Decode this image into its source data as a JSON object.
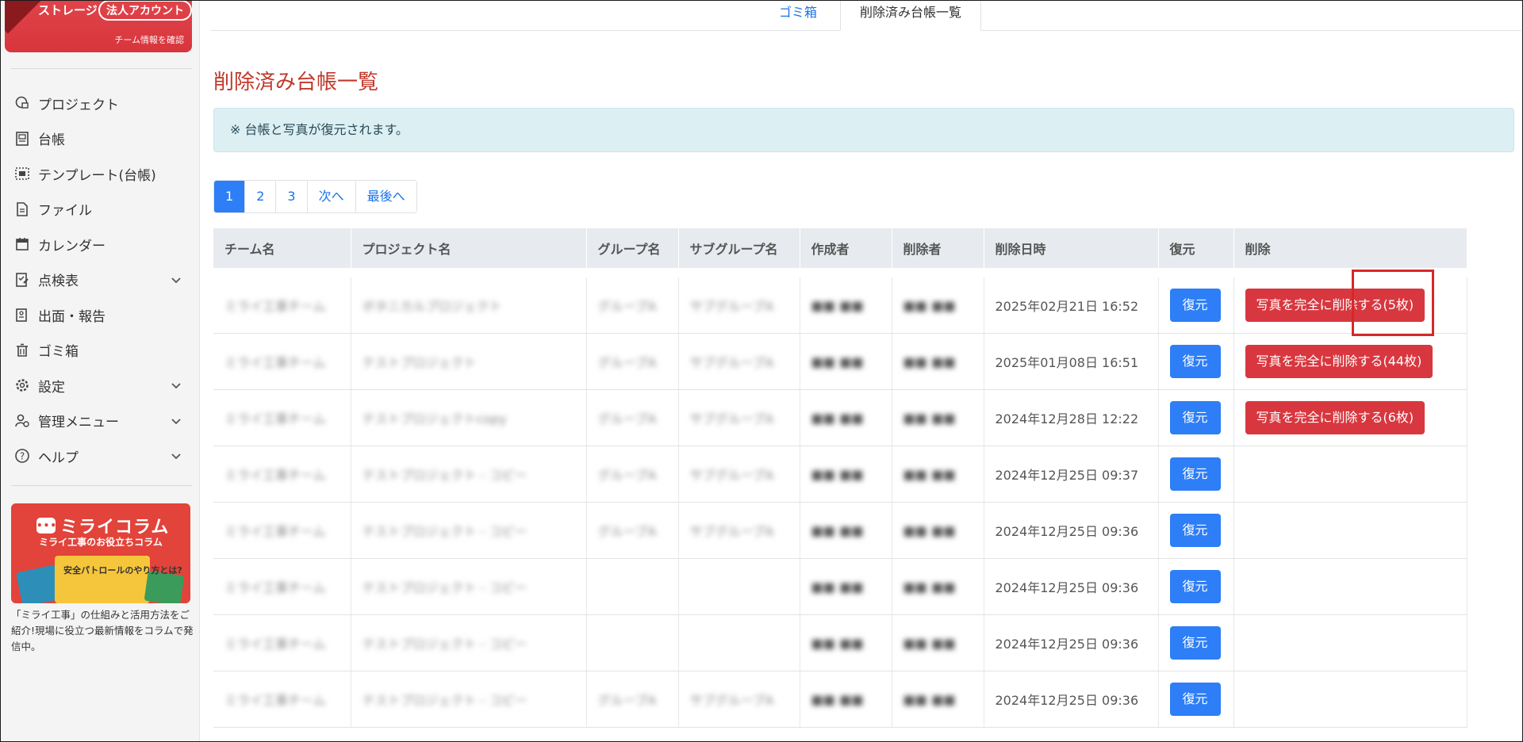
{
  "sidebar": {
    "storage_label": "ストレージ",
    "account_badge": "法人アカウント",
    "team_link": "チーム情報を確認",
    "items": [
      {
        "label": "プロジェクト",
        "icon": "project-icon",
        "chevron": false
      },
      {
        "label": "台帳",
        "icon": "ledger-icon",
        "chevron": false
      },
      {
        "label": "テンプレート(台帳)",
        "icon": "template-icon",
        "chevron": false
      },
      {
        "label": "ファイル",
        "icon": "file-icon",
        "chevron": false
      },
      {
        "label": "カレンダー",
        "icon": "calendar-icon",
        "chevron": false
      },
      {
        "label": "点検表",
        "icon": "checklist-icon",
        "chevron": true
      },
      {
        "label": "出面・報告",
        "icon": "report-icon",
        "chevron": false
      },
      {
        "label": "ゴミ箱",
        "icon": "trash-icon",
        "chevron": false
      },
      {
        "label": "設定",
        "icon": "gear-icon",
        "chevron": true
      },
      {
        "label": "管理メニュー",
        "icon": "admin-icon",
        "chevron": true
      },
      {
        "label": "ヘルプ",
        "icon": "help-icon",
        "chevron": true
      }
    ],
    "ad": {
      "logo": "ミライコラム",
      "subtitle": "ミライ工事のお役立ちコラム",
      "art_text": "安全パトロールのやり方とは?",
      "description": "「ミライ工事」の仕組みと活用方法をご紹介!現場に役立つ最新情報をコラムで発信中。"
    }
  },
  "tabs": [
    "ゴミ箱",
    "削除済み台帳一覧"
  ],
  "page_title": "削除済み台帳一覧",
  "alert_text": "※ 台帳と写真が復元されます。",
  "pagination": [
    "1",
    "2",
    "3",
    "次へ",
    "最後へ"
  ],
  "table": {
    "headers": [
      "チーム名",
      "プロジェクト名",
      "グループ名",
      "サブグループ名",
      "作成者",
      "削除者",
      "削除日時",
      "復元",
      "削除"
    ],
    "rows": [
      {
        "team": "ミライ工事チーム",
        "project": "ボタニカルプロジェクト",
        "group": "グループA",
        "subgroup": "サブグループA",
        "creator": "■■ ■■",
        "deleter": "■■ ■■",
        "date": "2025年02月21日 16:52",
        "restore": "復元",
        "delete": "写真を完全に削除する(5枚)"
      },
      {
        "team": "ミライ工事チーム",
        "project": "テストプロジェクト",
        "group": "グループA",
        "subgroup": "サブグループA",
        "creator": "■■ ■■",
        "deleter": "■■ ■■",
        "date": "2025年01月08日 16:51",
        "restore": "復元",
        "delete": "写真を完全に削除する(44枚)"
      },
      {
        "team": "ミライ工事チーム",
        "project": "テストプロジェクトcopy",
        "group": "グループA",
        "subgroup": "サブグループA",
        "creator": "■■ ■■",
        "deleter": "■■ ■■",
        "date": "2024年12月28日 12:22",
        "restore": "復元",
        "delete": "写真を完全に削除する(6枚)"
      },
      {
        "team": "ミライ工事チーム",
        "project": "テストプロジェクト - コピー",
        "group": "グループA",
        "subgroup": "サブグループA",
        "creator": "■■ ■■",
        "deleter": "■■ ■■",
        "date": "2024年12月25日 09:37",
        "restore": "復元",
        "delete": ""
      },
      {
        "team": "ミライ工事チーム",
        "project": "テストプロジェクト - コピー",
        "group": "グループA",
        "subgroup": "サブグループA",
        "creator": "■■ ■■",
        "deleter": "■■ ■■",
        "date": "2024年12月25日 09:36",
        "restore": "復元",
        "delete": ""
      },
      {
        "team": "ミライ工事チーム",
        "project": "テストプロジェクト - コピー",
        "group": "",
        "subgroup": "",
        "creator": "■■ ■■",
        "deleter": "■■ ■■",
        "date": "2024年12月25日 09:36",
        "restore": "復元",
        "delete": ""
      },
      {
        "team": "ミライ工事チーム",
        "project": "テストプロジェクト - コピー",
        "group": "",
        "subgroup": "",
        "creator": "■■ ■■",
        "deleter": "■■ ■■",
        "date": "2024年12月25日 09:36",
        "restore": "復元",
        "delete": ""
      },
      {
        "team": "ミライ工事チーム",
        "project": "テストプロジェクト - コピー",
        "group": "グループA",
        "subgroup": "サブグループA",
        "creator": "■■ ■■",
        "deleter": "■■ ■■",
        "date": "2024年12月25日 09:36",
        "restore": "復元",
        "delete": ""
      }
    ]
  },
  "colors": {
    "accent_red": "#c0392b",
    "primary_blue": "#2d7ef7",
    "danger_red": "#d8373f",
    "highlight_red": "#d62828"
  }
}
